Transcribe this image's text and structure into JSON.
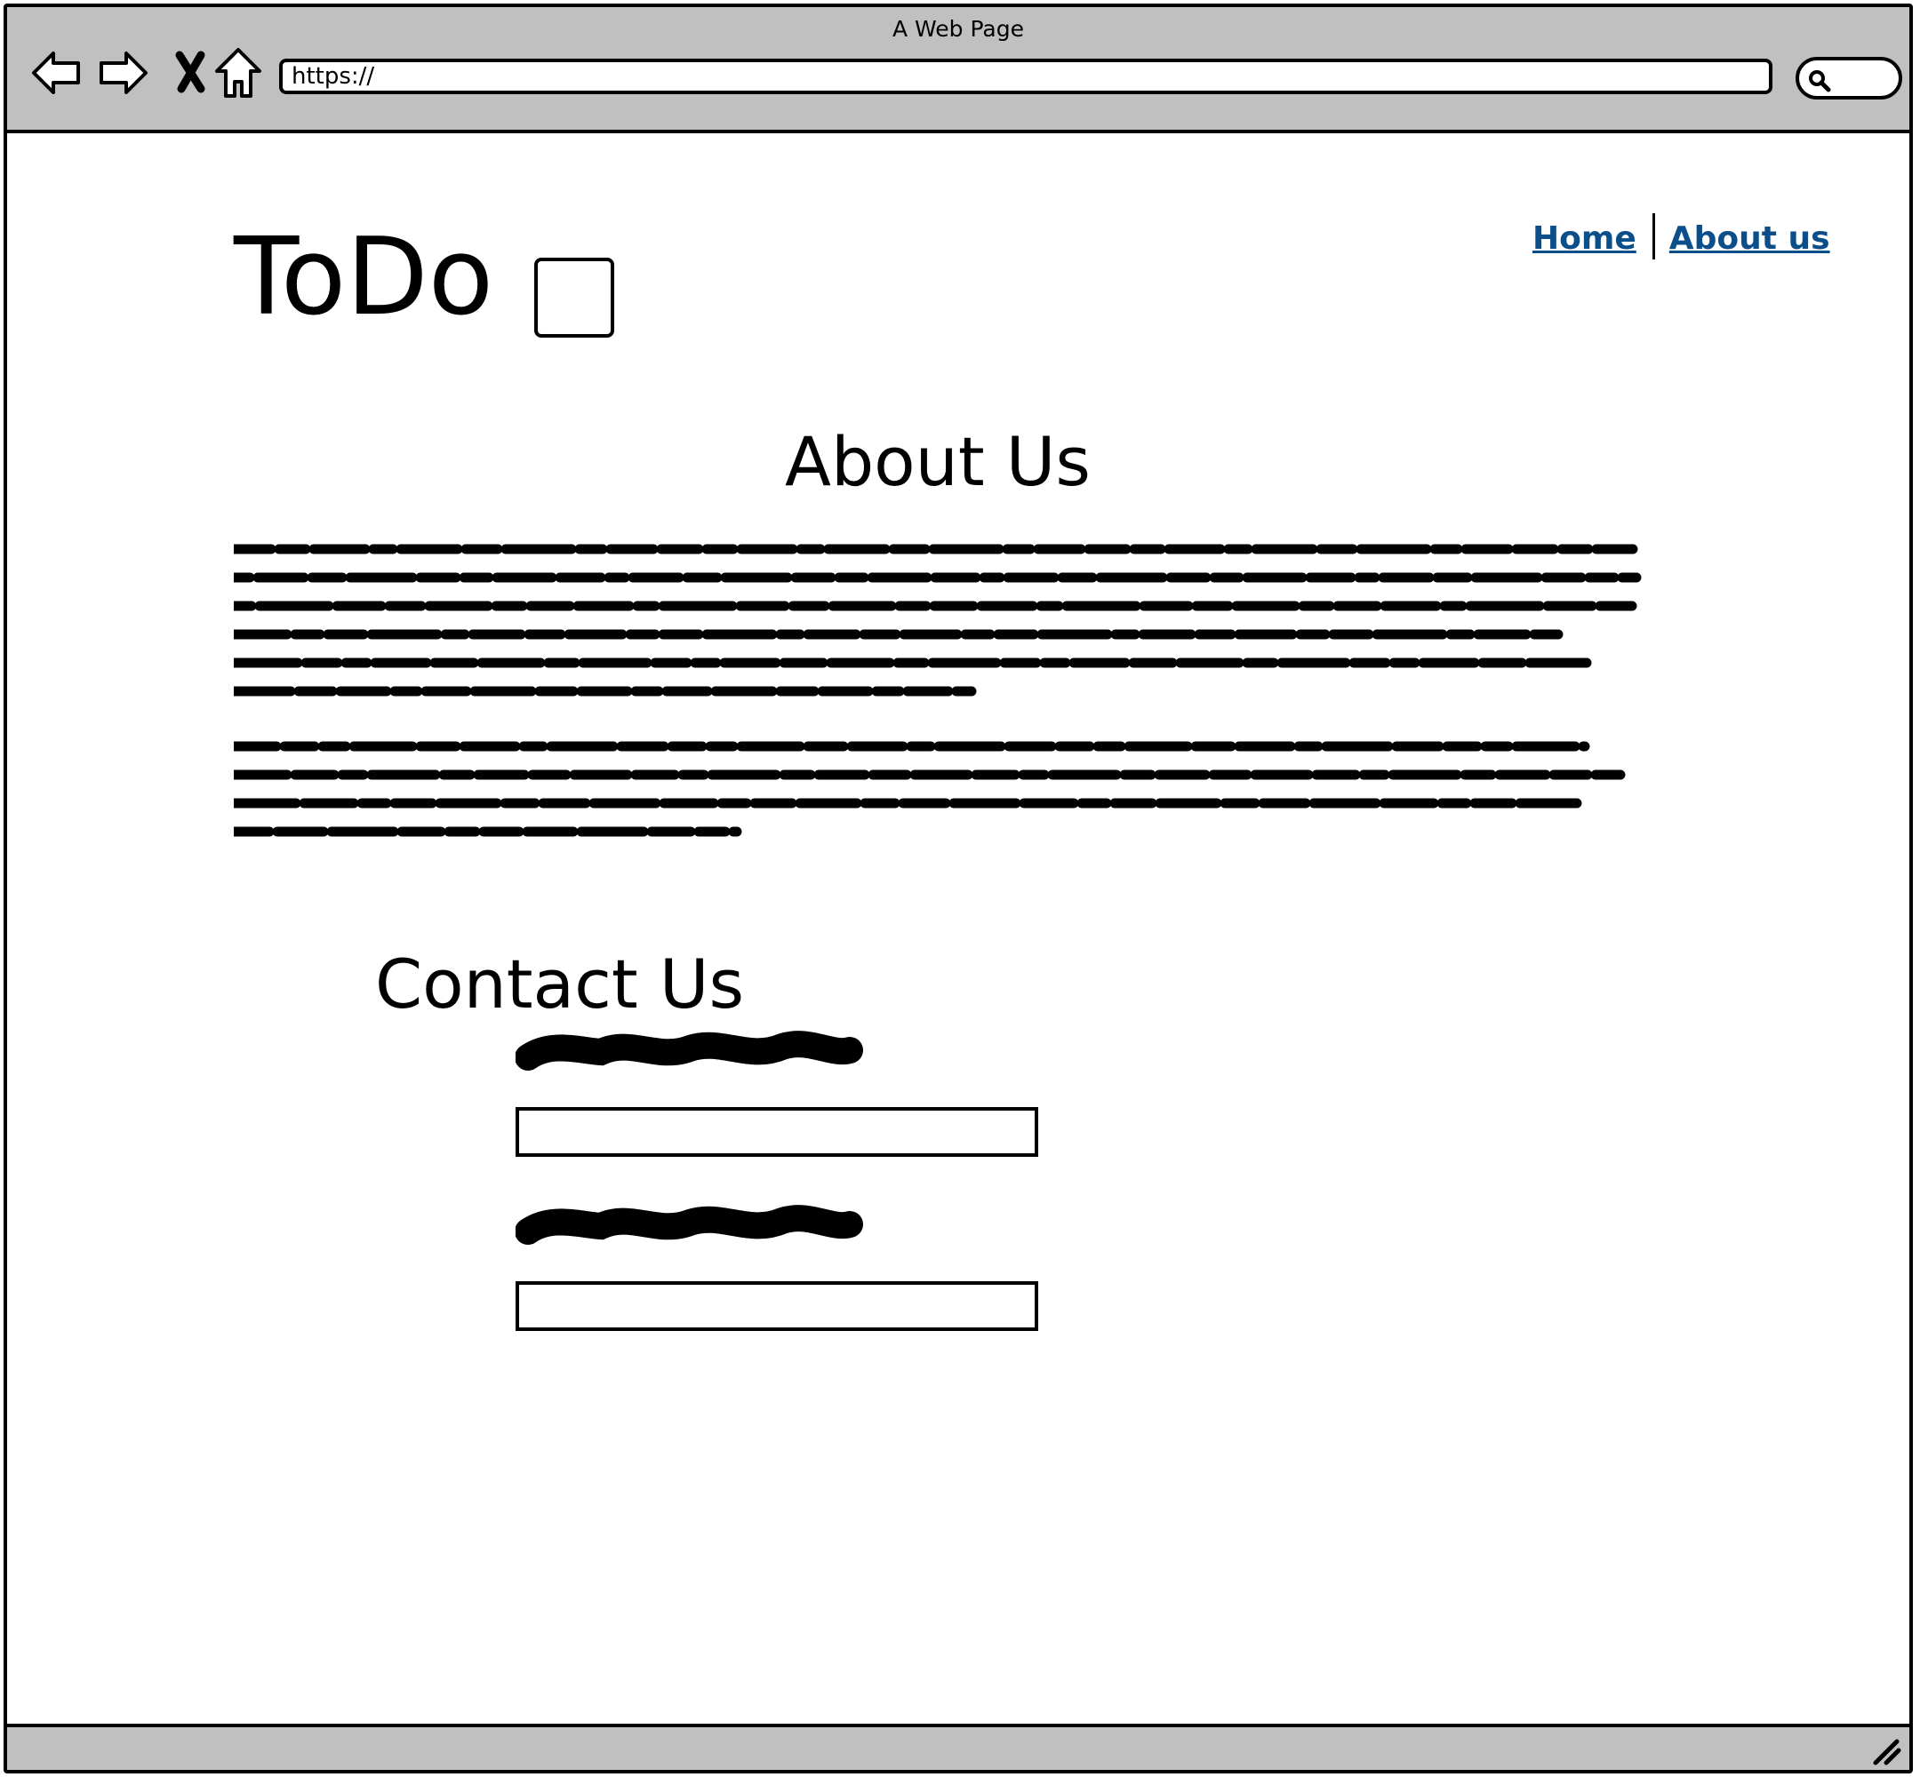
{
  "window": {
    "title": "A Web Page"
  },
  "toolbar": {
    "back_icon": "arrow-left-icon",
    "forward_icon": "arrow-right-icon",
    "stop_icon": "close-icon",
    "home_icon": "home-icon",
    "search_icon": "search-icon"
  },
  "address_bar": {
    "value": "https://"
  },
  "header": {
    "logo_text": "ToDo",
    "nav": [
      {
        "label": "Home"
      },
      {
        "label": "About us"
      }
    ]
  },
  "about": {
    "title": "About Us"
  },
  "contact": {
    "title": "Contact Us"
  },
  "colors": {
    "chrome": "#c0c0c0",
    "link": "#0b4f8a",
    "ink": "#000000"
  }
}
